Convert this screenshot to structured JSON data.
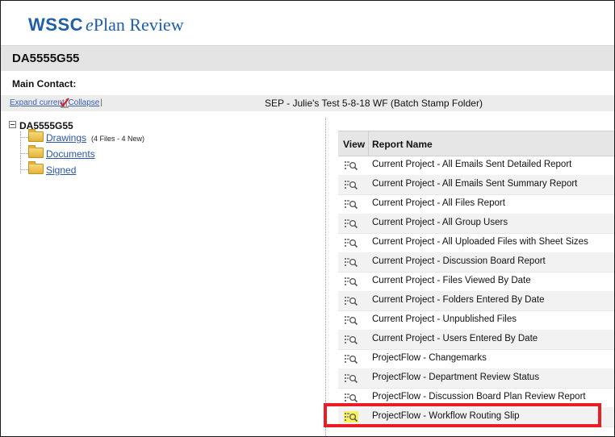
{
  "header": {
    "logo_brand": "WSSC",
    "logo_e": "e",
    "logo_rest": "Plan Review"
  },
  "project": {
    "id": "DA5555G55"
  },
  "main_contact_label": "Main Contact:",
  "toolbar": {
    "expand_label": "Expand current",
    "separator": "|",
    "collapse_label": "Collapse",
    "folder_title": "SEP - Julie's Test 5-8-18 WF (Batch Stamp Folder)",
    "check_icon_color": "#d2232a"
  },
  "tree": {
    "root_label": "DA5555G55",
    "nodes": [
      {
        "label": "Drawings",
        "count": "(4 Files - 4 New)",
        "icon": "folder-icon"
      },
      {
        "label": "Documents",
        "count": "",
        "icon": "folder-icon"
      },
      {
        "label": "Signed",
        "count": "",
        "icon": "folder-icon"
      }
    ]
  },
  "reports": {
    "col_view": "View",
    "col_name": "Report Name",
    "rows": [
      {
        "name": "Current Project - All Emails Sent Detailed Report",
        "icon": "report-view-icon"
      },
      {
        "name": "Current Project - All Emails Sent Summary Report",
        "icon": "report-view-icon"
      },
      {
        "name": "Current Project - All Files Report",
        "icon": "report-view-icon"
      },
      {
        "name": "Current Project - All Group Users",
        "icon": "report-view-icon"
      },
      {
        "name": "Current Project - All Uploaded Files with Sheet Sizes",
        "icon": "report-view-icon"
      },
      {
        "name": "Current Project - Discussion Board Report",
        "icon": "report-view-icon"
      },
      {
        "name": "Current Project - Files Viewed By Date",
        "icon": "report-view-icon"
      },
      {
        "name": "Current Project - Folders Entered By Date",
        "icon": "report-view-icon"
      },
      {
        "name": "Current Project - Unpublished Files",
        "icon": "report-view-icon"
      },
      {
        "name": "Current Project - Users Entered By Date",
        "icon": "report-view-icon"
      },
      {
        "name": "ProjectFlow - Changemarks",
        "icon": "report-view-icon"
      },
      {
        "name": "ProjectFlow - Department Review Status",
        "icon": "report-view-icon"
      },
      {
        "name": "ProjectFlow - Discussion Board Plan Review Report",
        "icon": "report-view-icon"
      },
      {
        "name": "ProjectFlow - Workflow Routing Slip",
        "icon": "report-view-icon",
        "highlighted": true
      }
    ]
  },
  "colors": {
    "brand_blue": "#1f5ea8",
    "highlight_red": "#ec1c24",
    "highlight_yellow": "#f7f25a"
  }
}
